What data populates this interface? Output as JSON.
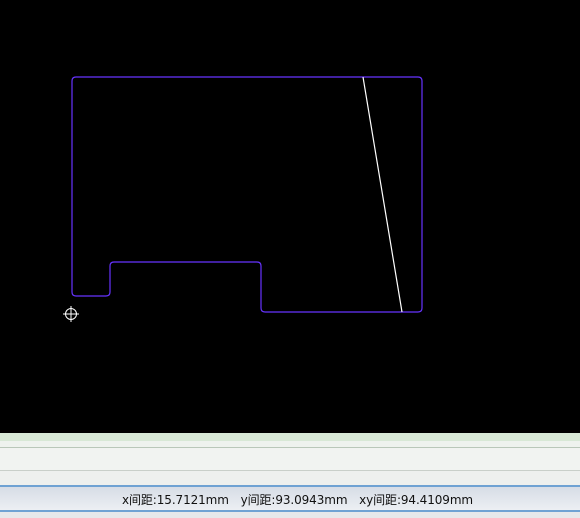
{
  "canvas": {
    "background": "#000000",
    "outline_color": "#6633ff",
    "cut_line_color": "#ffffff",
    "cursor_icon": "crosshair-circle-icon"
  },
  "status": {
    "x_distance": "x间距:15.7121mm",
    "y_distance": "y间距:93.0943mm",
    "xy_distance": "xy间距:94.4109mm"
  }
}
